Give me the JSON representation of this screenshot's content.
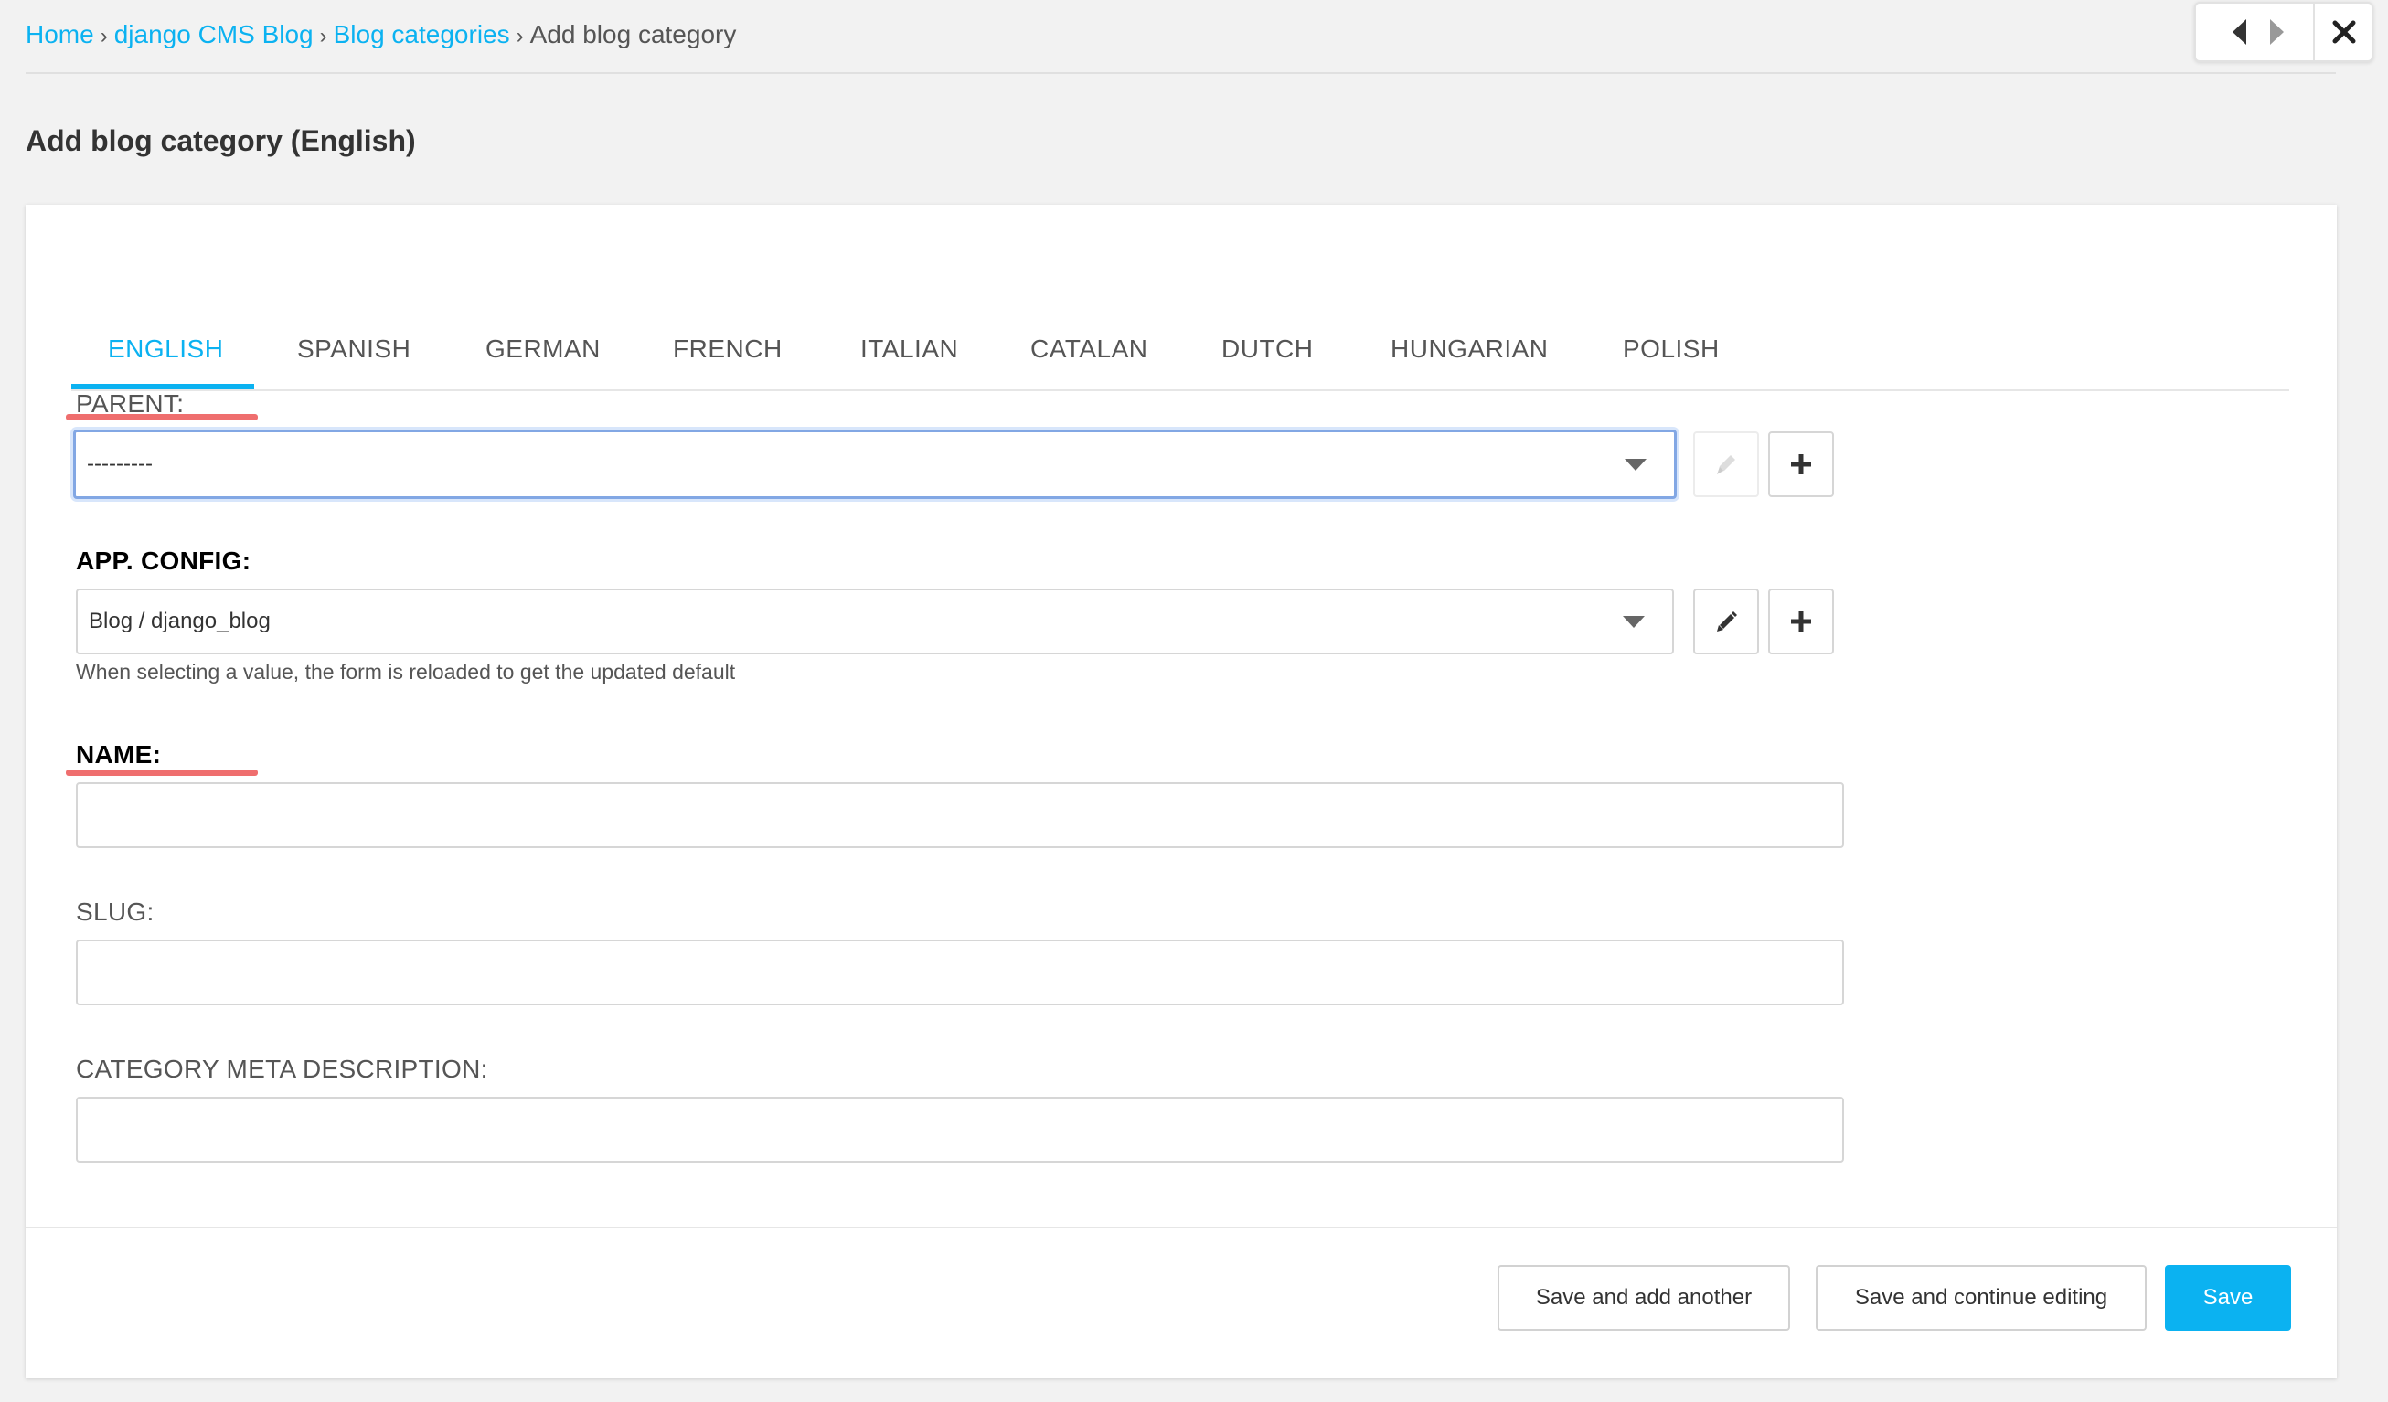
{
  "breadcrumbs": {
    "home": "Home",
    "app": "django CMS Blog",
    "section": "Blog categories",
    "current": "Add blog category",
    "separator": "›"
  },
  "object_tools": {
    "prev_icon": "caret-left-icon",
    "next_icon": "caret-right-icon",
    "close_icon": "close-icon"
  },
  "page_title": "Add blog category (English)",
  "tabs": [
    {
      "label": "ENGLISH",
      "active": true
    },
    {
      "label": "SPANISH"
    },
    {
      "label": "GERMAN"
    },
    {
      "label": "FRENCH"
    },
    {
      "label": "ITALIAN"
    },
    {
      "label": "CATALAN"
    },
    {
      "label": "DUTCH"
    },
    {
      "label": "HUNGARIAN"
    },
    {
      "label": "POLISH"
    }
  ],
  "fields": {
    "parent": {
      "label": "PARENT:",
      "value": "---------"
    },
    "app_config": {
      "label": "APP. CONFIG:",
      "value": "Blog / django_blog",
      "help": "When selecting a value, the form is reloaded to get the updated default"
    },
    "name": {
      "label": "NAME:",
      "value": ""
    },
    "slug": {
      "label": "SLUG:",
      "value": ""
    },
    "meta_description": {
      "label": "CATEGORY META DESCRIPTION:",
      "value": ""
    }
  },
  "actions": {
    "save_add_another": "Save and add another",
    "save_continue": "Save and continue editing",
    "save": "Save"
  },
  "colors": {
    "accent": "#0bb2f1",
    "annotation_underline": "#ef6e6e",
    "focus_border": "#82a7e4"
  }
}
